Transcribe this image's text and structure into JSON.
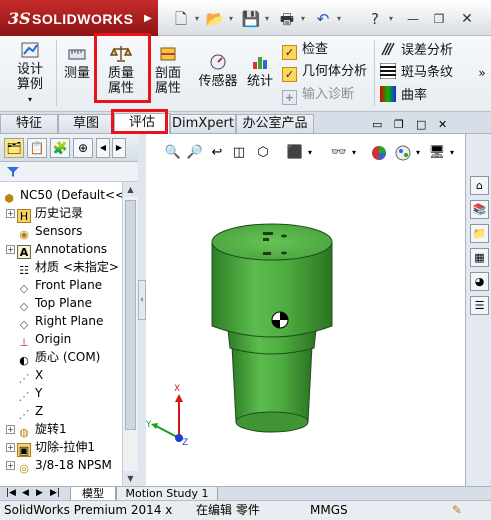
{
  "app": {
    "logo_ds": "3S",
    "logo_name": "SOLIDWORKS",
    "quick_access": [
      "new-icon",
      "open-icon",
      "save-icon",
      "print-icon",
      "undo-icon"
    ],
    "help": "?"
  },
  "ribbon": {
    "design_study": "设计算例",
    "measure": "测量",
    "mass_props": "质量属性",
    "section_props": "剖面属性",
    "sensor": "传感器",
    "statistics": "统计",
    "checks": [
      {
        "label": "检查",
        "enabled": true
      },
      {
        "label": "几何体分析",
        "enabled": true
      },
      {
        "label": "输入诊断",
        "enabled": false
      }
    ],
    "right_tools": [
      "误差分析",
      "斑马条纹",
      "曲率"
    ],
    "more": "»"
  },
  "tabs": [
    {
      "label": "特征",
      "active": false
    },
    {
      "label": "草图",
      "active": false
    },
    {
      "label": "评估",
      "active": true
    },
    {
      "label": "DimXpert",
      "active": false
    },
    {
      "label": "办公室产品",
      "active": false
    }
  ],
  "tree": {
    "root": "NC50  (Default<<",
    "items": [
      {
        "label": "历史记录",
        "icon": "history-icon",
        "expandable": true
      },
      {
        "label": "Sensors",
        "icon": "sensor-icon",
        "expandable": false
      },
      {
        "label": "Annotations",
        "icon": "annotation-icon",
        "expandable": true
      },
      {
        "label": "材质 <未指定>",
        "icon": "material-icon",
        "expandable": false
      },
      {
        "label": "Front Plane",
        "icon": "plane-icon",
        "expandable": false
      },
      {
        "label": "Top Plane",
        "icon": "plane-icon",
        "expandable": false
      },
      {
        "label": "Right Plane",
        "icon": "plane-icon",
        "expandable": false
      },
      {
        "label": "Origin",
        "icon": "origin-icon",
        "expandable": false
      },
      {
        "label": "质心 (COM)",
        "icon": "com-icon",
        "expandable": false
      },
      {
        "label": "X",
        "icon": "axis-icon",
        "expandable": false
      },
      {
        "label": "Y",
        "icon": "axis-icon",
        "expandable": false
      },
      {
        "label": "Z",
        "icon": "axis-icon",
        "expandable": false
      },
      {
        "label": "旋转1",
        "icon": "revolve-icon",
        "expandable": true
      },
      {
        "label": "切除-拉伸1",
        "icon": "cut-extrude-icon",
        "expandable": true
      },
      {
        "label": "3/8-18 NPSM",
        "icon": "hole-icon",
        "expandable": true
      }
    ]
  },
  "triad": {
    "x": "X",
    "y": "Y",
    "z": "Z"
  },
  "bottom_tabs": [
    {
      "label": "模型",
      "active": true
    },
    {
      "label": "Motion Study 1",
      "active": false
    }
  ],
  "status": {
    "product": "SolidWorks Premium 2014 x",
    "mode": "在编辑 零件",
    "units": "MMGS"
  },
  "colors": {
    "part_green": "#52b044",
    "highlight_red": "#e8141a",
    "logo_red": "#b01f1f"
  }
}
